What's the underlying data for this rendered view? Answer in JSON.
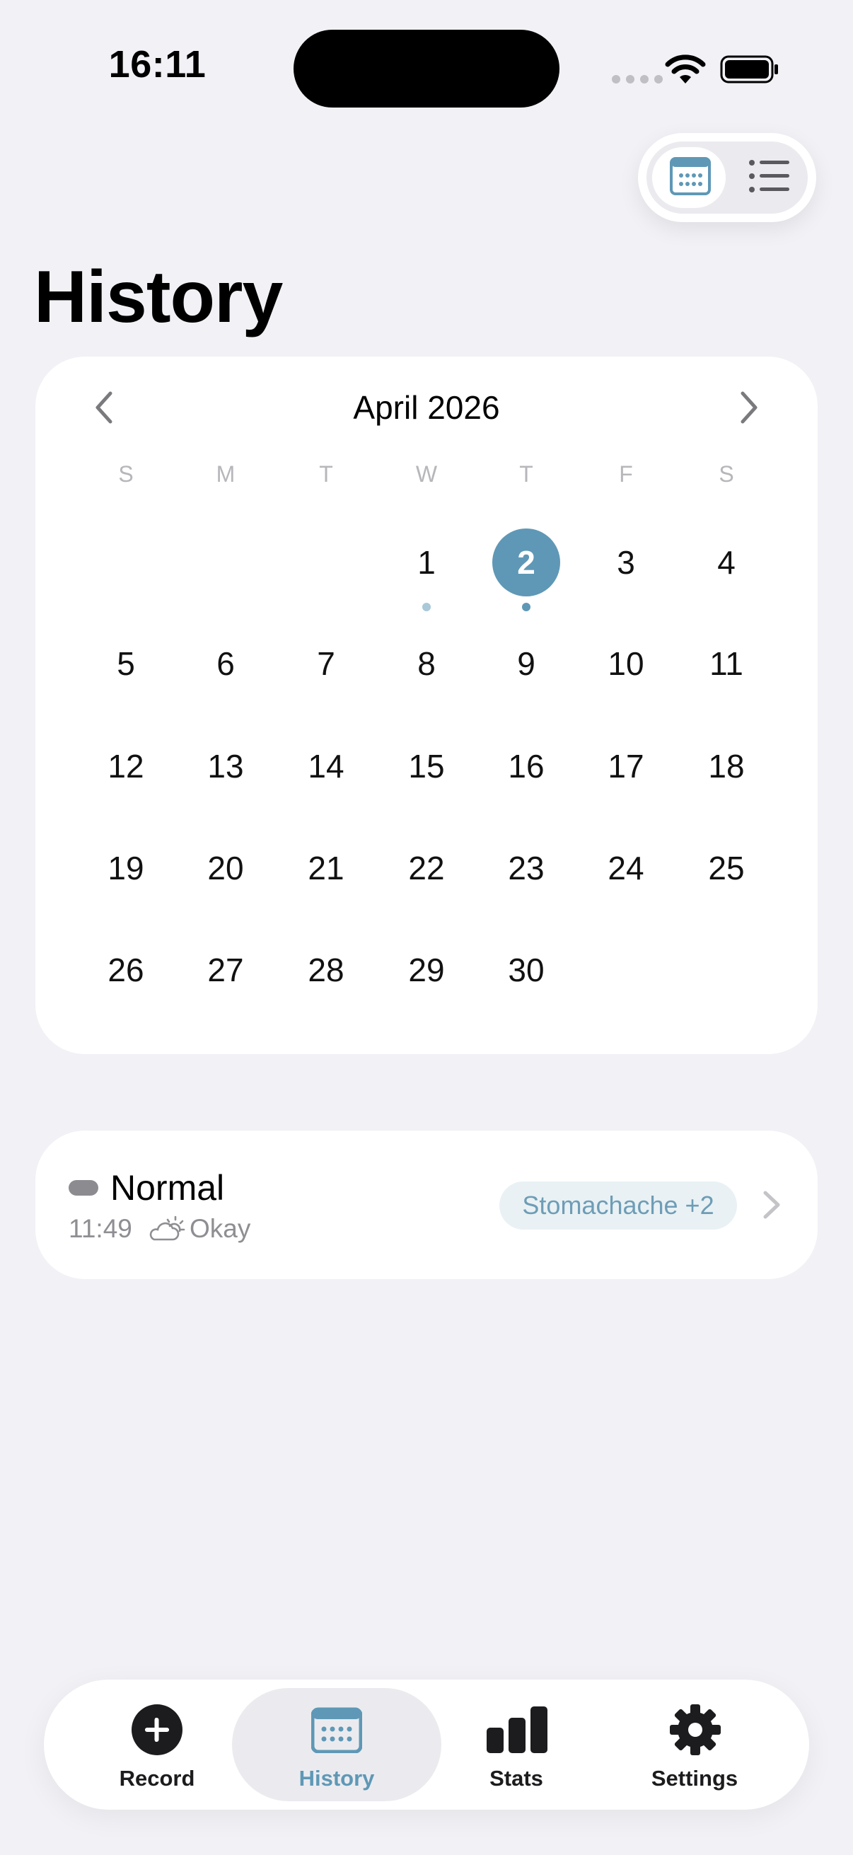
{
  "status_bar": {
    "time": "16:11"
  },
  "page": {
    "title": "History"
  },
  "calendar": {
    "month_label": "April 2026",
    "weekdays": [
      "S",
      "M",
      "T",
      "W",
      "T",
      "F",
      "S"
    ],
    "first_weekday_index": 3,
    "days_in_month": 30,
    "selected_day": 2,
    "days_with_entries": [
      1,
      2
    ],
    "colors": {
      "accent": "#5F98B6",
      "dot_light": "#A9C8D8",
      "dot_dark": "#5F98B6"
    }
  },
  "entry": {
    "title": "Normal",
    "time": "11:49",
    "mood": "Okay",
    "mood_icon": "partly-sunny-icon",
    "tag": "Stomachache +2"
  },
  "tabs": [
    {
      "label": "Record",
      "icon": "plus-circle-icon",
      "active": false
    },
    {
      "label": "History",
      "icon": "calendar-icon",
      "active": true
    },
    {
      "label": "Stats",
      "icon": "bar-chart-icon",
      "active": false
    },
    {
      "label": "Settings",
      "icon": "gear-icon",
      "active": false
    }
  ]
}
